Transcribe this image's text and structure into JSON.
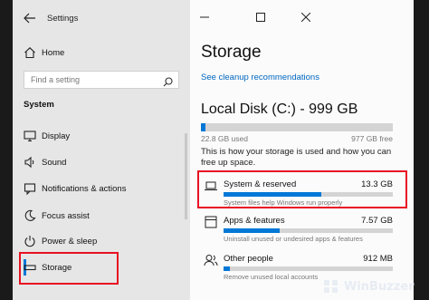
{
  "window": {
    "app_title": "Settings"
  },
  "nav": {
    "home_label": "Home",
    "search_placeholder": "Find a setting",
    "section_label": "System",
    "items": [
      {
        "label": "Display",
        "icon": "display-icon"
      },
      {
        "label": "Sound",
        "icon": "sound-icon"
      },
      {
        "label": "Notifications & actions",
        "icon": "notifications-icon"
      },
      {
        "label": "Focus assist",
        "icon": "focus-assist-icon"
      },
      {
        "label": "Power & sleep",
        "icon": "power-icon"
      },
      {
        "label": "Storage",
        "icon": "storage-icon",
        "selected": true
      }
    ]
  },
  "main": {
    "title": "Storage",
    "cleanup_link": "See cleanup recommendations",
    "disk_title": "Local Disk (C:) - 999 GB",
    "used_fraction": 0.023,
    "used_label": "22.8 GB used",
    "free_label": "977 GB free",
    "description": "This is how your storage is used and how you can free up space.",
    "categories": [
      {
        "name": "System & reserved",
        "size": "13.3 GB",
        "sub": "System files help Windows run properly",
        "fill": 0.58,
        "icon": "laptop-icon"
      },
      {
        "name": "Apps & features",
        "size": "7.57 GB",
        "sub": "Uninstall unused or undesired apps & features",
        "fill": 0.33,
        "icon": "apps-icon"
      },
      {
        "name": "Other people",
        "size": "912 MB",
        "sub": "Remove unused local accounts",
        "fill": 0.04,
        "icon": "people-icon"
      }
    ]
  },
  "watermark": {
    "text": "WinBuzzer"
  },
  "colors": {
    "accent": "#0078d7",
    "highlight": "#e81123",
    "nav_bg": "#e6e6e6",
    "main_bg": "#fbfbfb"
  }
}
